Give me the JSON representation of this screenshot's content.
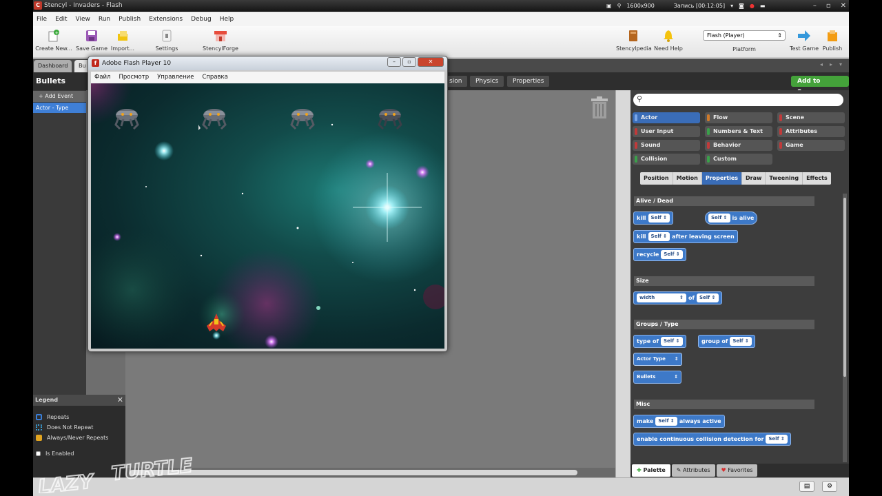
{
  "window": {
    "title": "Stencyl - Invaders - Flash",
    "app_icon_letter": "C",
    "recording": {
      "resolution": "1600x900",
      "label": "Запись [00:12:05]"
    }
  },
  "menu": [
    "File",
    "Edit",
    "View",
    "Run",
    "Publish",
    "Extensions",
    "Debug",
    "Help"
  ],
  "toolbar": {
    "create_new": "Create New...",
    "save_game": "Save Game",
    "import": "Import...",
    "settings": "Settings",
    "stencylforge": "StencylForge",
    "stencylpedia": "Stencylpedia",
    "need_help": "Need Help",
    "platform_value": "Flash (Player)",
    "platform_label": "Platform",
    "test_game": "Test Game",
    "publish": "Publish"
  },
  "tabs": {
    "dashboard": "Dashboard",
    "bullets_short": "Bu"
  },
  "subheader": {
    "name": "Bullets",
    "tab_sion": "sion",
    "tab_physics": "Physics",
    "tab_properties": "Properties",
    "add_to_scene": "Add to Scene"
  },
  "events": {
    "add_event": "+ Add Event",
    "actor_type": "Actor - Type"
  },
  "legend": {
    "title": "Legend",
    "close": "✕",
    "items": [
      "Repeats",
      "Does Not Repeat",
      "Always/Never Repeats",
      "Is Enabled"
    ],
    "colors": [
      "#3a7fd9",
      "#3aa0d9",
      "#e2a520",
      "#ffffff"
    ]
  },
  "palette": {
    "categories": [
      {
        "label": "Actor",
        "color": "#4a78c4"
      },
      {
        "label": "Flow",
        "color": "#d07a2a"
      },
      {
        "label": "Scene",
        "color": "#c03a3a"
      },
      {
        "label": "User Input",
        "color": "#c03a3a"
      },
      {
        "label": "Numbers & Text",
        "color": "#3aa04a"
      },
      {
        "label": "Attributes",
        "color": "#c03a3a"
      },
      {
        "label": "Sound",
        "color": "#c03a3a"
      },
      {
        "label": "Behavior",
        "color": "#c03a3a"
      },
      {
        "label": "Game",
        "color": "#c03a3a"
      },
      {
        "label": "Collision",
        "color": "#3aa04a"
      },
      {
        "label": "Custom",
        "color": "#3aa04a"
      }
    ],
    "subtabs": [
      "Position",
      "Motion",
      "Properties",
      "Draw",
      "Tweening",
      "Effects"
    ],
    "sections": {
      "alive_dead": "Alive / Dead",
      "size": "Size",
      "groups_type": "Groups / Type",
      "misc": "Misc"
    },
    "blocks": {
      "kill": "kill",
      "self": "Self",
      "is_alive": "is alive",
      "after_leaving_screen": "after leaving screen",
      "recycle": "recycle",
      "width": "width",
      "of": "of",
      "type_of": "type of",
      "group_of": "group of",
      "actor_type": "Actor Type",
      "bullets": "Bullets",
      "make": "make",
      "always_active": "always active",
      "enable_ccd": "enable continuous collision detection for"
    },
    "bottom_tabs": [
      "Palette",
      "Attributes",
      "Favorites"
    ]
  },
  "flash_player": {
    "title": "Adobe Flash Player 10",
    "menu": [
      "Файл",
      "Просмотр",
      "Управление",
      "Справка"
    ]
  },
  "watermark": "LAZY TURTLE"
}
